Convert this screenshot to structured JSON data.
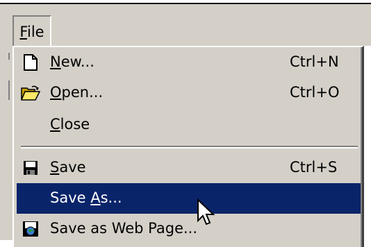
{
  "menubar": {
    "file": {
      "accel": "F",
      "rest": "ile"
    }
  },
  "menu": {
    "items": [
      {
        "icon": "new-document-icon",
        "pre": "",
        "accel": "N",
        "post": "ew...",
        "shortcut": "Ctrl+N",
        "highlighted": false
      },
      {
        "icon": "open-folder-icon",
        "pre": "",
        "accel": "O",
        "post": "pen...",
        "shortcut": "Ctrl+O",
        "highlighted": false
      },
      {
        "icon": "",
        "pre": "",
        "accel": "C",
        "post": "lose",
        "shortcut": "",
        "highlighted": false
      },
      {
        "icon": "floppy-disk-icon",
        "pre": "",
        "accel": "S",
        "post": "ave",
        "shortcut": "Ctrl+S",
        "highlighted": false
      },
      {
        "icon": "",
        "pre": "Save ",
        "accel": "A",
        "post": "s...",
        "shortcut": "",
        "highlighted": true
      },
      {
        "icon": "save-as-web-page-icon",
        "pre": "Save as Web Page...",
        "accel": "",
        "post": "",
        "shortcut": "",
        "highlighted": false
      }
    ]
  },
  "colors": {
    "face": "#d4d0c8",
    "highlight": "#0a246a",
    "highlight_text": "#ffffff",
    "shadow": "#808080"
  }
}
